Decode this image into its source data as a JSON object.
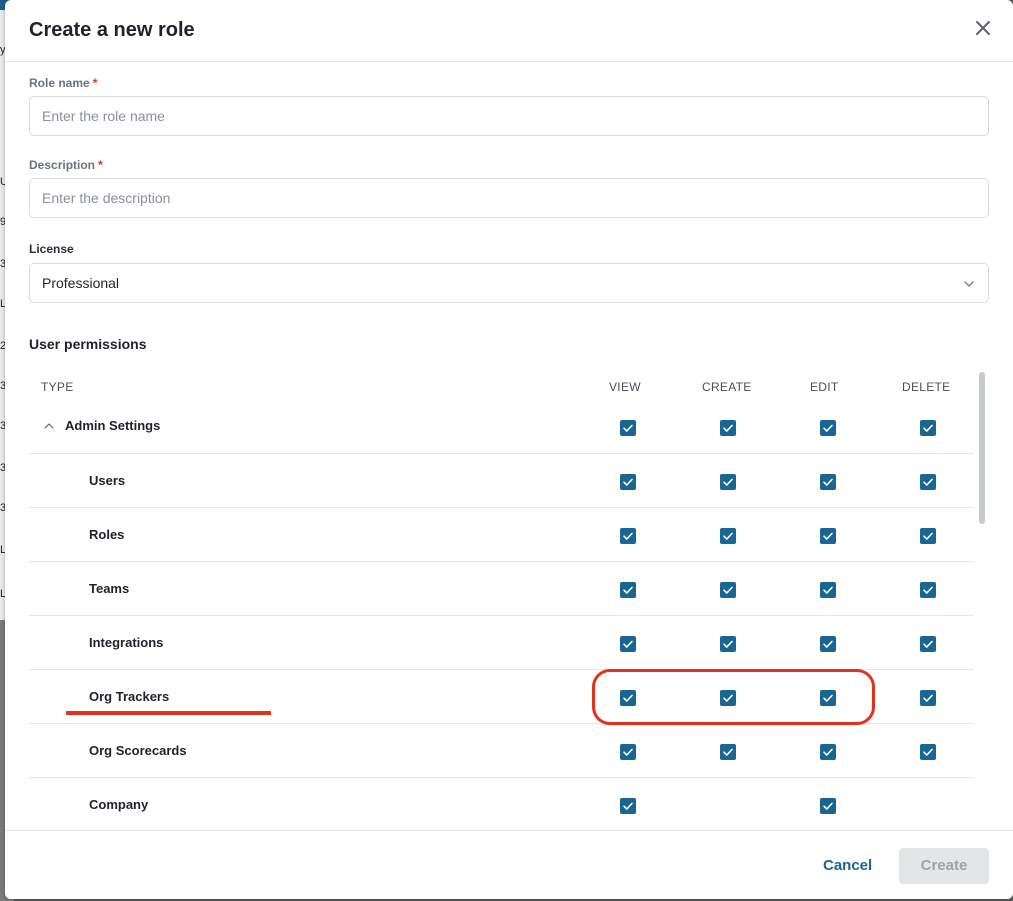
{
  "dialog": {
    "title": "Create a new role"
  },
  "form": {
    "role_name": {
      "label": "Role name",
      "required_mark": "*",
      "placeholder": "Enter the role name",
      "value": ""
    },
    "description": {
      "label": "Description",
      "required_mark": "*",
      "placeholder": "Enter the description",
      "value": ""
    },
    "license": {
      "label": "License",
      "selected": "Professional"
    }
  },
  "permissions": {
    "section_title": "User permissions",
    "columns": [
      "TYPE",
      "VIEW",
      "CREATE",
      "EDIT",
      "DELETE"
    ],
    "rows": [
      {
        "name": "Admin Settings",
        "level": "parent",
        "expanded": true,
        "view": true,
        "create": true,
        "edit": true,
        "delete": true
      },
      {
        "name": "Users",
        "level": "child",
        "view": true,
        "create": true,
        "edit": true,
        "delete": true
      },
      {
        "name": "Roles",
        "level": "child",
        "view": true,
        "create": true,
        "edit": true,
        "delete": true
      },
      {
        "name": "Teams",
        "level": "child",
        "view": true,
        "create": true,
        "edit": true,
        "delete": true
      },
      {
        "name": "Integrations",
        "level": "child",
        "view": true,
        "create": true,
        "edit": true,
        "delete": true
      },
      {
        "name": "Org Trackers",
        "level": "child",
        "view": true,
        "create": true,
        "edit": true,
        "delete": true
      },
      {
        "name": "Org Scorecards",
        "level": "child",
        "view": true,
        "create": true,
        "edit": true,
        "delete": true
      },
      {
        "name": "Company",
        "level": "child",
        "view": true,
        "create": null,
        "edit": true,
        "delete": null
      }
    ]
  },
  "footer": {
    "cancel_label": "Cancel",
    "create_label": "Create"
  },
  "background_fragments": [
    "y",
    "U",
    "9",
    "3",
    "L",
    "2",
    "3",
    "3",
    "3",
    "3",
    "L",
    "L"
  ],
  "colors": {
    "accent": "#1a6692",
    "annotation": "#e3311c",
    "required": "#d93025",
    "disabled_button_bg": "#e4e5e7"
  }
}
